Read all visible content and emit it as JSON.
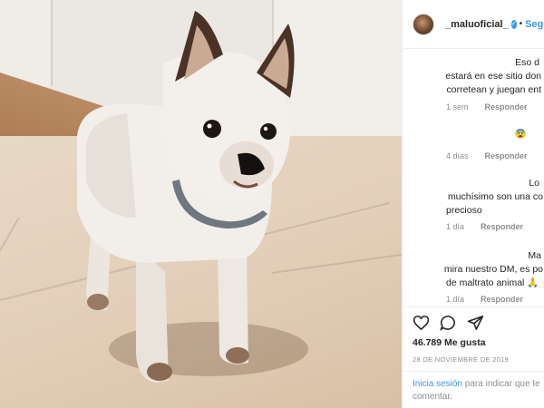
{
  "post": {
    "username": "_maluoficial_",
    "follow_label": "Seg"
  },
  "comments": [
    {
      "lines": [
        "Eso d",
        "estará en ese sitio don",
        "corretean y juegan ent"
      ],
      "time": "1 sem",
      "reply": "Responder"
    },
    {
      "lines": [
        "😨"
      ],
      "time": "4 días",
      "reply": "Responder"
    },
    {
      "lines": [
        "Lo",
        "muchísimo son una co",
        "precioso"
      ],
      "time": "1 día",
      "reply": "Responder"
    },
    {
      "lines": [
        "Ma",
        "mira nuestro DM, es po",
        "de maltrato animal 🙏"
      ],
      "time": "1 día",
      "reply": "Responder"
    }
  ],
  "footer": {
    "likes": "46.789 Me gusta",
    "date": "28 DE NOVIEMBRE DE 2019",
    "login_link": "Inicia sesión",
    "login_rest": " para indicar que te",
    "login_line2": "comentar."
  },
  "colors": {
    "accent": "#3897f0",
    "muted": "#8e8e8e",
    "text": "#262626"
  },
  "icons": [
    "heart-icon",
    "comment-icon",
    "share-icon",
    "verified-badge-icon"
  ]
}
